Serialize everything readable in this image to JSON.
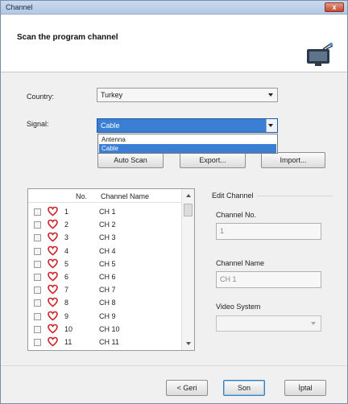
{
  "window": {
    "title": "Channel",
    "close_label": "x"
  },
  "header": {
    "heading": "Scan the program channel"
  },
  "form": {
    "country_label": "Country:",
    "country_value": "Turkey",
    "signal_label": "Signal:",
    "signal_value": "Cable",
    "signal_options": [
      "Antenna",
      "Cable"
    ]
  },
  "buttons": {
    "auto_scan": "Auto Scan",
    "export": "Export...",
    "import": "Import..."
  },
  "channel_list": {
    "columns": [
      "No.",
      "Channel Name"
    ],
    "rows": [
      {
        "no": "1",
        "name": "CH 1"
      },
      {
        "no": "2",
        "name": "CH 2"
      },
      {
        "no": "3",
        "name": "CH 3"
      },
      {
        "no": "4",
        "name": "CH 4"
      },
      {
        "no": "5",
        "name": "CH 5"
      },
      {
        "no": "6",
        "name": "CH 6"
      },
      {
        "no": "7",
        "name": "CH 7"
      },
      {
        "no": "8",
        "name": "CH 8"
      },
      {
        "no": "9",
        "name": "CH 9"
      },
      {
        "no": "10",
        "name": "CH 10"
      },
      {
        "no": "11",
        "name": "CH 11"
      }
    ]
  },
  "edit_channel": {
    "group_label": "Edit Channel",
    "channel_no_label": "Channel No.",
    "channel_no_value": "1",
    "channel_name_label": "Channel Name",
    "channel_name_value": "CH 1",
    "video_system_label": "Video System",
    "video_system_value": ""
  },
  "footer": {
    "back": "< Geri",
    "finish": "Son",
    "cancel": "İptal"
  },
  "colors": {
    "selection": "#3a7fd4",
    "heart": "#d0202a"
  }
}
